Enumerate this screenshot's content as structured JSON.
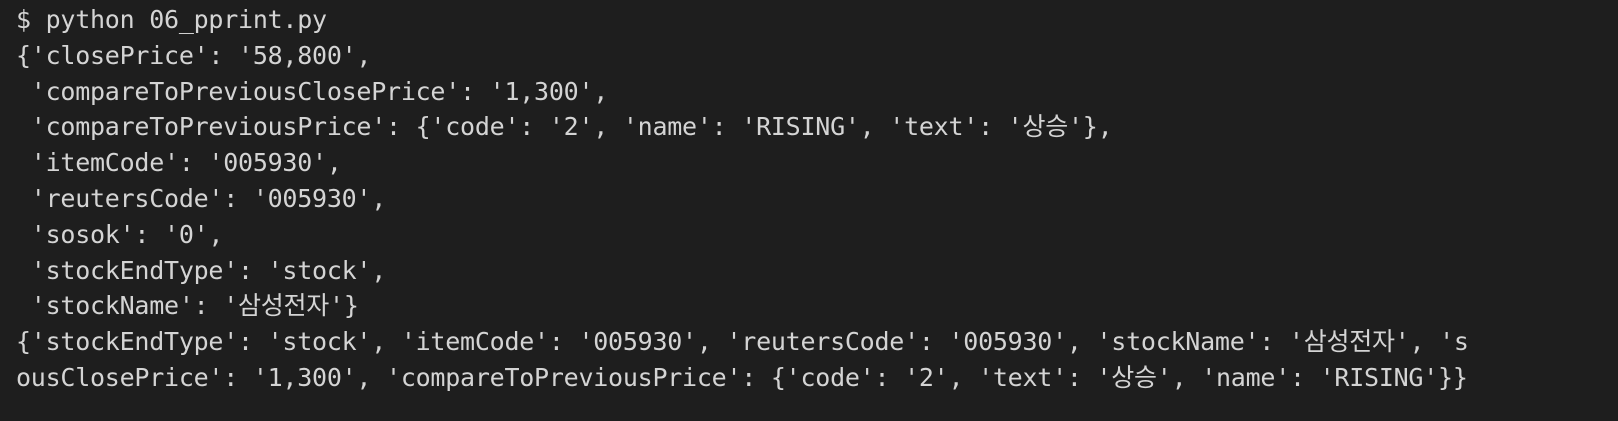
{
  "terminal": {
    "lines": [
      "$ python 06_pprint.py",
      "{'closePrice': '58,800',",
      " 'compareToPreviousClosePrice': '1,300',",
      " 'compareToPreviousPrice': {'code': '2', 'name': 'RISING', 'text': '상승'},",
      " 'itemCode': '005930',",
      " 'reutersCode': '005930',",
      " 'sosok': '0',",
      " 'stockEndType': 'stock',",
      " 'stockName': '삼성전자'}",
      "{'stockEndType': 'stock', 'itemCode': '005930', 'reutersCode': '005930', 'stockName': '삼성전자', 's",
      "ousClosePrice': '1,300', 'compareToPreviousPrice': {'code': '2', 'text': '상승', 'name': 'RISING'}}"
    ]
  },
  "colors": {
    "background": "#1e1e1e",
    "foreground": "#d4d4d4"
  }
}
